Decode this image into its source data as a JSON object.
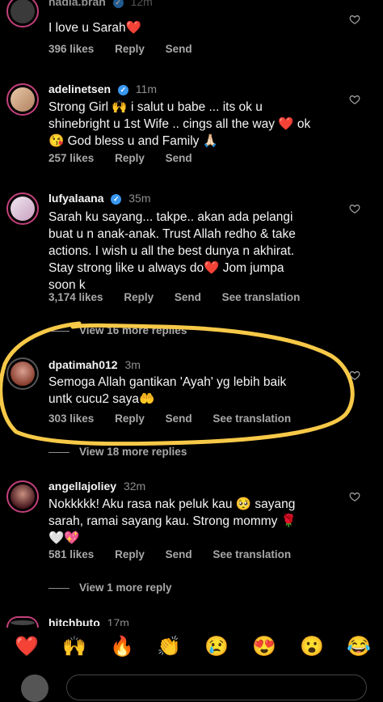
{
  "comments": [
    {
      "username": "hadia.bran",
      "time": "12m",
      "text": "I love u Sarah❤️",
      "likes": "396 likes",
      "reply": "Reply",
      "send": "Send"
    },
    {
      "username": "adelinetsen",
      "time": "11m",
      "text_lines": [
        "Strong Girl 🙌 i salut u babe ... its ok u",
        "shinebright u 1st Wife .. cings all the way ❤️ ok",
        "😘 God bless u and Family 🙏🏻"
      ],
      "likes": "257 likes",
      "reply": "Reply",
      "send": "Send"
    },
    {
      "username": "lufyalaana",
      "time": "35m",
      "text_lines": [
        "Sarah ku sayang... takpe.. akan ada pelangi",
        "buat u n anak-anak. Trust Allah redho & take",
        "actions. I wish u all the best dunya n akhirat.",
        "Stay strong like u always do❤️ Jom jumpa",
        "soon k"
      ],
      "likes": "3,174 likes",
      "reply": "Reply",
      "send": "Send",
      "see_translation": "See translation",
      "view_replies": "View 16 more replies"
    },
    {
      "username": "dpatimah012",
      "time": "3m",
      "text_lines": [
        "Semoga Allah gantikan 'Ayah' yg lebih baik",
        "untk cucu2 saya🤲"
      ],
      "likes": "303 likes",
      "reply": "Reply",
      "send": "Send",
      "see_translation": "See translation",
      "view_replies": "View 18 more replies"
    },
    {
      "username": "angellajoliey",
      "time": "32m",
      "text_lines": [
        "Nokkkkk! Aku rasa nak peluk kau 🥺 sayang",
        "sarah, ramai sayang kau. Strong mommy 🌹",
        "🤍💖"
      ],
      "likes": "581 likes",
      "reply": "Reply",
      "send": "Send",
      "see_translation": "See translation",
      "view_replies": "View 1 more reply"
    },
    {
      "username": "hitchbuto",
      "time": "17m"
    }
  ],
  "emoji_bar": [
    "❤️",
    "🙌",
    "🔥",
    "👏",
    "😢",
    "😍",
    "😮",
    "😂"
  ],
  "colors": {
    "background": "#000000",
    "secondary_text": "#a8a8a8",
    "verified": "#3897f0",
    "annotation": "#f7c948"
  }
}
